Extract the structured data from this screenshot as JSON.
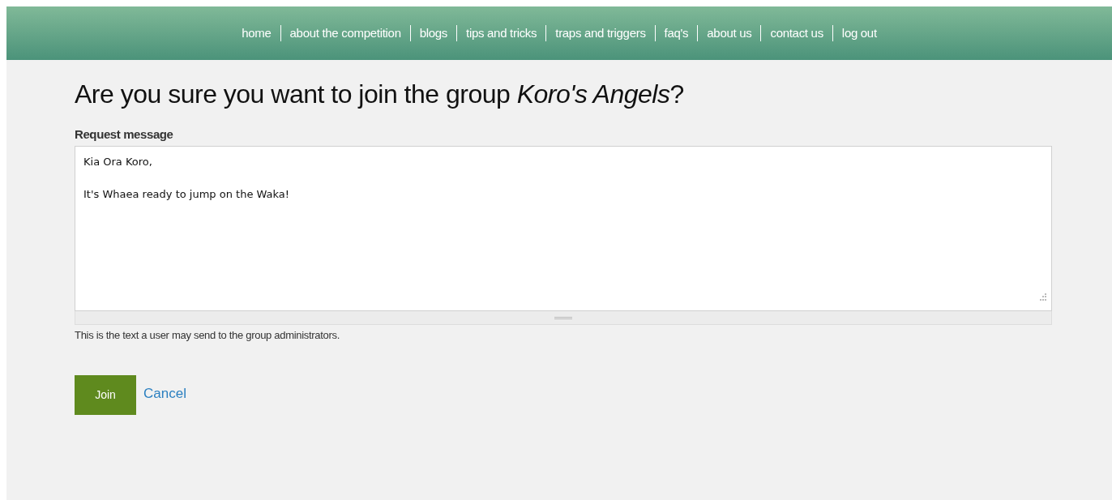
{
  "nav": [
    {
      "label": "home"
    },
    {
      "label": "about the competition"
    },
    {
      "label": "blogs"
    },
    {
      "label": "tips and tricks"
    },
    {
      "label": "traps and triggers"
    },
    {
      "label": "faq's"
    },
    {
      "label": "about us"
    },
    {
      "label": "contact us"
    },
    {
      "label": "log out"
    }
  ],
  "heading": "Are you sure you want to join the group *Koro's Angels*?",
  "request_message": {
    "label": "Request message",
    "value": "Kia Ora Koro,\n\nIt's Whaea ready to jump on the Waka!",
    "description": "This is the text a user may send to the group administrators."
  },
  "buttons": {
    "join": "Join",
    "cancel": "Cancel"
  }
}
